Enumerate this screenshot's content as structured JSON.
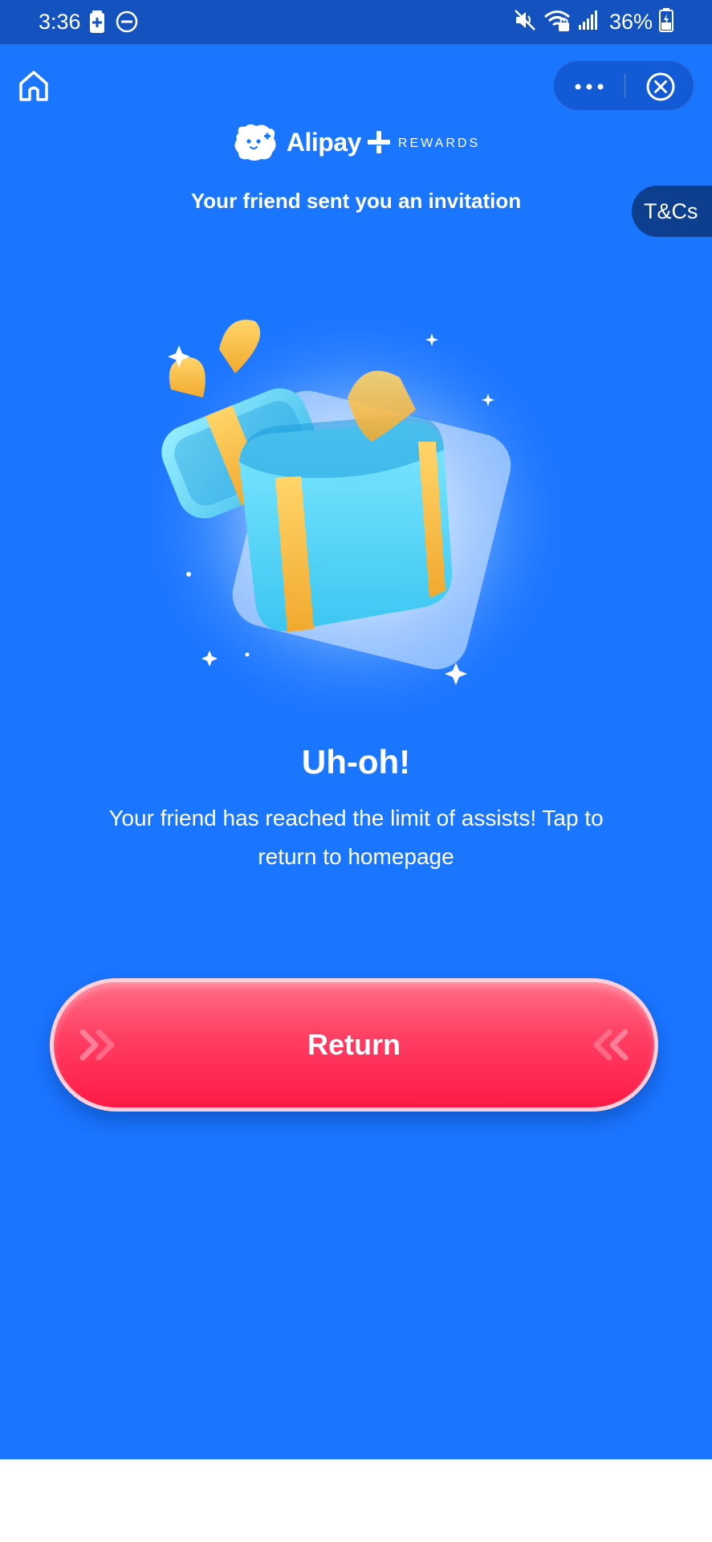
{
  "status_bar": {
    "time": "3:36",
    "battery_percent": "36%",
    "icons": [
      "battery-saver-icon",
      "do-not-disturb-icon",
      "mute-icon",
      "wifi-icon",
      "signal-icon",
      "battery-icon"
    ]
  },
  "nav": {
    "home_icon": "home-icon",
    "more_icon": "more-dots-icon",
    "close_icon": "close-circle-icon"
  },
  "header": {
    "brand_name": "Alipay",
    "brand_suffix": "REWARDS",
    "invitation_text": "Your friend sent you an invitation",
    "tcs_label": "T&Cs"
  },
  "main": {
    "illustration": "open-gift-box",
    "headline": "Uh-oh!",
    "message": "Your friend has reached the limit of assists! Tap to return to homepage",
    "return_label": "Return"
  },
  "colors": {
    "status_bar": "#1452c0",
    "background": "#1a75ff",
    "button_top": "#ff6d86",
    "button_bottom": "#ff1a47",
    "tcs_tab": "#0e3f8e"
  }
}
